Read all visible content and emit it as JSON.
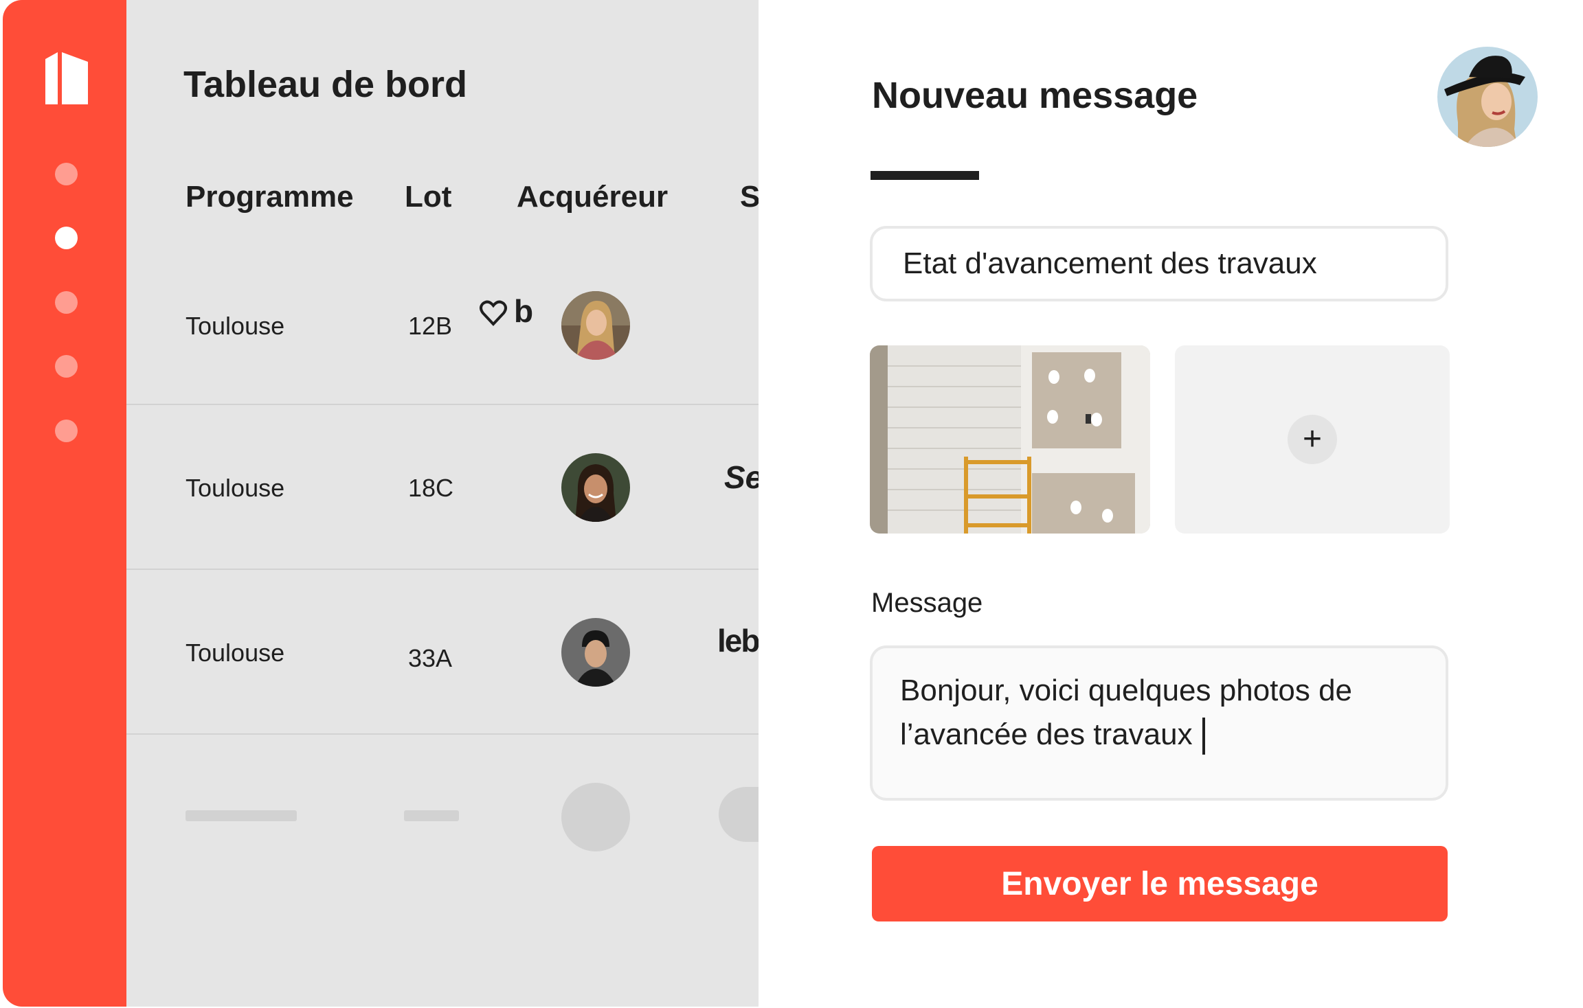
{
  "colors": {
    "accent": "#ff4d38",
    "dashboard_bg": "#e5e5e5",
    "text": "#1f1f1f"
  },
  "sidebar": {
    "logo_icon": "building-logo-icon",
    "nav_items": [
      {
        "icon": "nav-dot",
        "active": false
      },
      {
        "icon": "nav-dot",
        "active": true
      },
      {
        "icon": "nav-dot",
        "active": false
      },
      {
        "icon": "nav-dot",
        "active": false
      },
      {
        "icon": "nav-dot",
        "active": false
      }
    ]
  },
  "dashboard": {
    "title": "Tableau de bord",
    "columns": [
      "Programme",
      "Lot",
      "Acquéreur",
      "Sc"
    ],
    "rows": [
      {
        "programme": "Toulouse",
        "lot": "12B",
        "brand": "b"
      },
      {
        "programme": "Toulouse",
        "lot": "18C",
        "brand": "Sel"
      },
      {
        "programme": "Toulouse",
        "lot": "33A",
        "brand": "lebo"
      }
    ]
  },
  "message_panel": {
    "title": "Nouveau message",
    "subject_value": "Etat d'avancement des travaux",
    "add_photo_symbol": "+",
    "message_label": "Message",
    "message_line1": "Bonjour, voici quelques photos de",
    "message_line2": "l’avancée des travaux",
    "send_label": "Envoyer le message"
  }
}
